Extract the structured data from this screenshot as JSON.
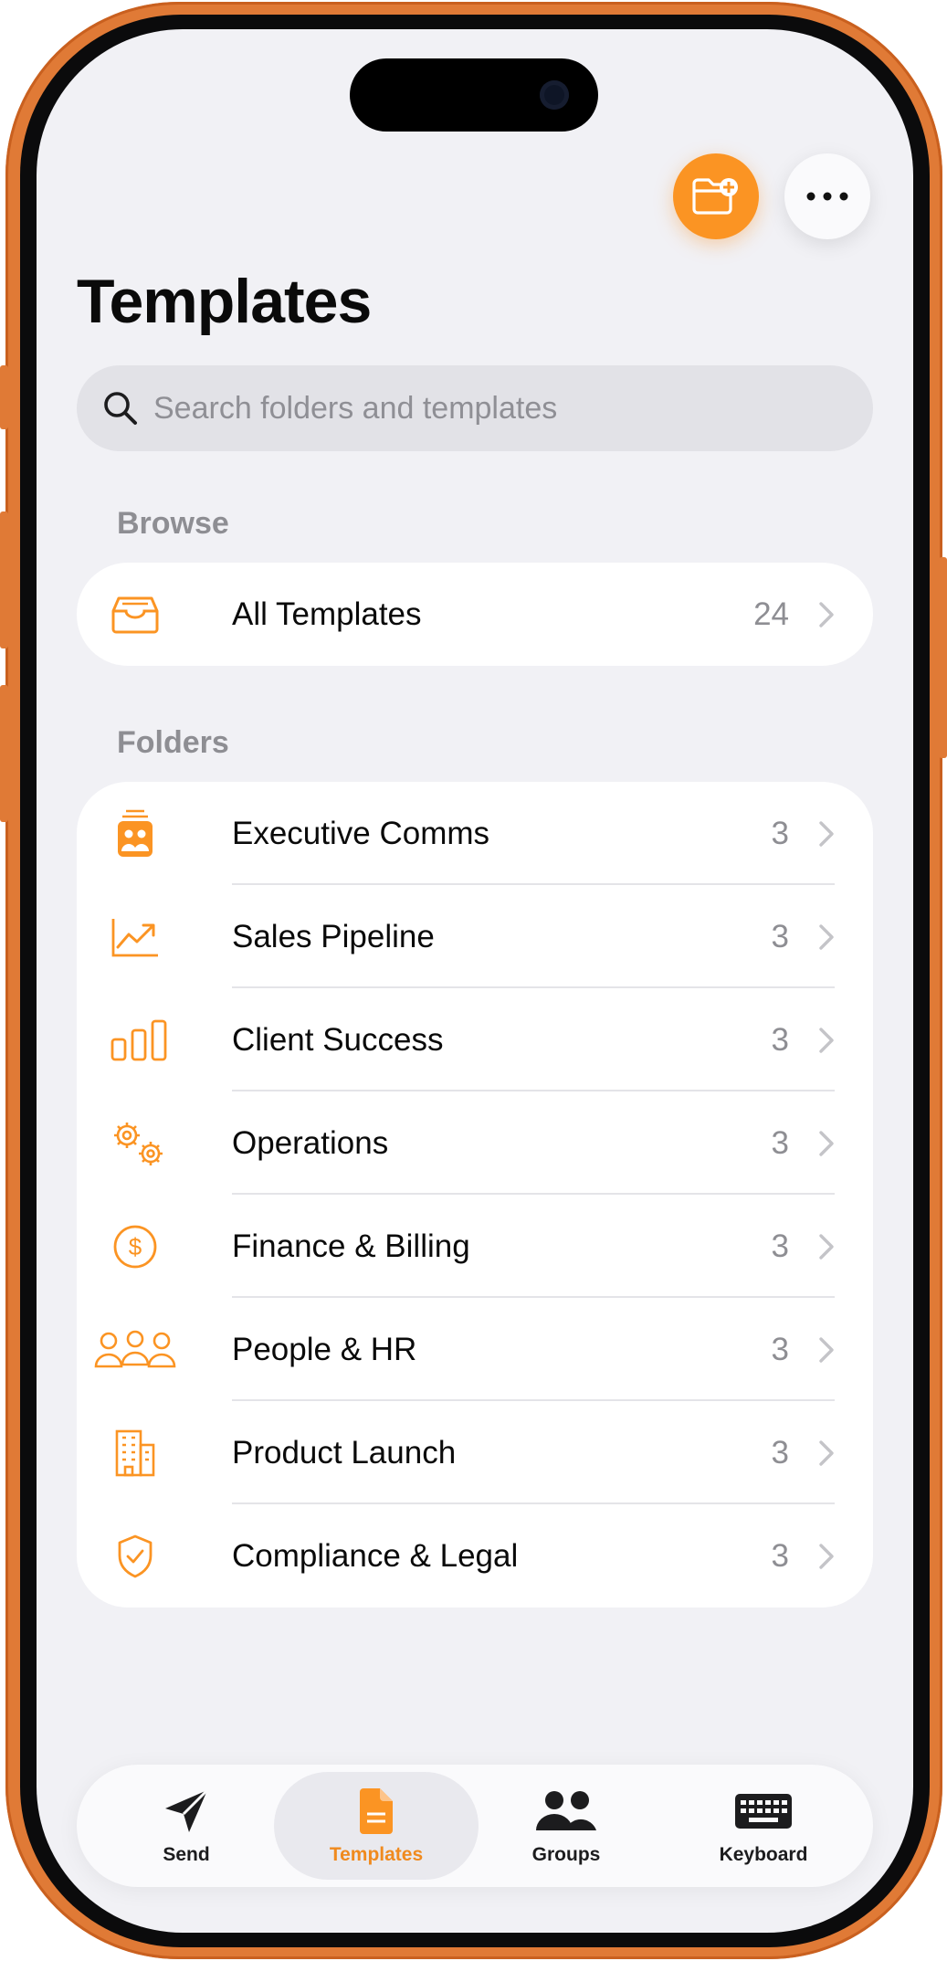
{
  "app": {
    "title": "Templates",
    "accent_color": "#fb9423"
  },
  "header_actions": {
    "add_folder_icon": "folder-plus-icon",
    "more_icon": "ellipsis-icon"
  },
  "search": {
    "placeholder": "Search folders and templates",
    "value": ""
  },
  "browse": {
    "section_label": "Browse",
    "items": [
      {
        "label": "All Templates",
        "count": "24",
        "icon": "tray-icon"
      }
    ]
  },
  "folders": {
    "section_label": "Folders",
    "items": [
      {
        "label": "Executive Comms",
        "count": "3",
        "icon": "podium-icon"
      },
      {
        "label": "Sales Pipeline",
        "count": "3",
        "icon": "trend-chart-icon"
      },
      {
        "label": "Client Success",
        "count": "3",
        "icon": "bar-chart-icon"
      },
      {
        "label": "Operations",
        "count": "3",
        "icon": "gears-icon"
      },
      {
        "label": "Finance & Billing",
        "count": "3",
        "icon": "dollar-circle-icon"
      },
      {
        "label": "People & HR",
        "count": "3",
        "icon": "people-icon"
      },
      {
        "label": "Product Launch",
        "count": "3",
        "icon": "building-icon"
      },
      {
        "label": "Compliance & Legal",
        "count": "3",
        "icon": "shield-check-icon"
      }
    ]
  },
  "tabbar": {
    "tabs": [
      {
        "label": "Send",
        "icon": "paperplane-icon",
        "active": false
      },
      {
        "label": "Templates",
        "icon": "document-icon",
        "active": true
      },
      {
        "label": "Groups",
        "icon": "two-people-icon",
        "active": false
      },
      {
        "label": "Keyboard",
        "icon": "keyboard-icon",
        "active": false
      }
    ]
  }
}
